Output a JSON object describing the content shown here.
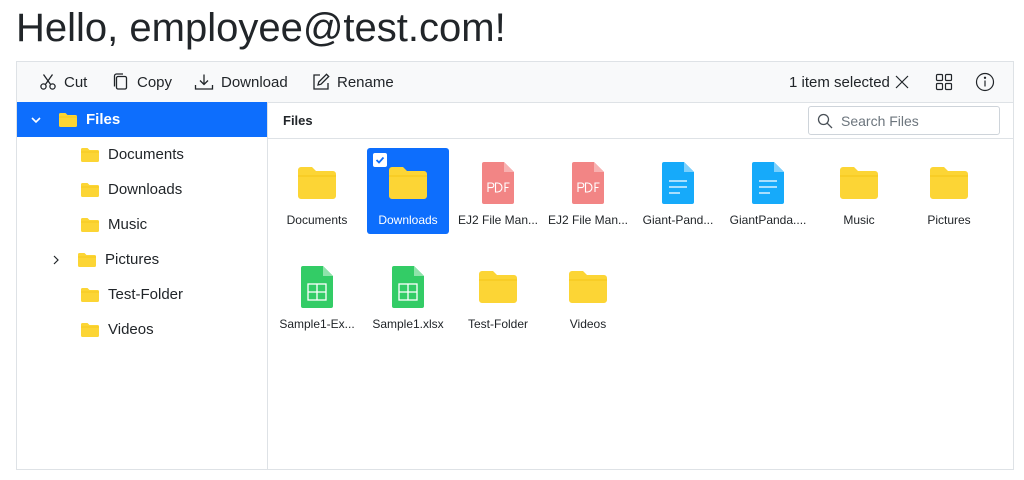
{
  "greeting": "Hello, employee@test.com!",
  "toolbar": {
    "cut": "Cut",
    "copy": "Copy",
    "download": "Download",
    "rename": "Rename",
    "selection_status": "1 item selected"
  },
  "nav": {
    "items": [
      {
        "label": "Files",
        "state": "expanded",
        "selected": true
      },
      {
        "label": "Documents"
      },
      {
        "label": "Downloads"
      },
      {
        "label": "Music"
      },
      {
        "label": "Pictures",
        "state": "collapsed"
      },
      {
        "label": "Test-Folder"
      },
      {
        "label": "Videos"
      }
    ]
  },
  "content": {
    "breadcrumb": "Files",
    "search_placeholder": "Search Files",
    "items": [
      {
        "label": "Documents",
        "type": "folder"
      },
      {
        "label": "Downloads",
        "type": "folder",
        "selected": true
      },
      {
        "label": "EJ2 File Man...",
        "type": "pdf"
      },
      {
        "label": "EJ2 File Man...",
        "type": "pdf"
      },
      {
        "label": "Giant-Pand...",
        "type": "doc"
      },
      {
        "label": "GiantPanda....",
        "type": "doc"
      },
      {
        "label": "Music",
        "type": "folder"
      },
      {
        "label": "Pictures",
        "type": "folder"
      },
      {
        "label": "Sample1-Ex...",
        "type": "sheet"
      },
      {
        "label": "Sample1.xlsx",
        "type": "sheet"
      },
      {
        "label": "Test-Folder",
        "type": "folder"
      },
      {
        "label": "Videos",
        "type": "folder"
      }
    ]
  },
  "colors": {
    "accent": "#0d6efd",
    "folder": "#fcd535",
    "pdf": "#f28585",
    "doc": "#16aafa",
    "sheet": "#33cc66"
  }
}
